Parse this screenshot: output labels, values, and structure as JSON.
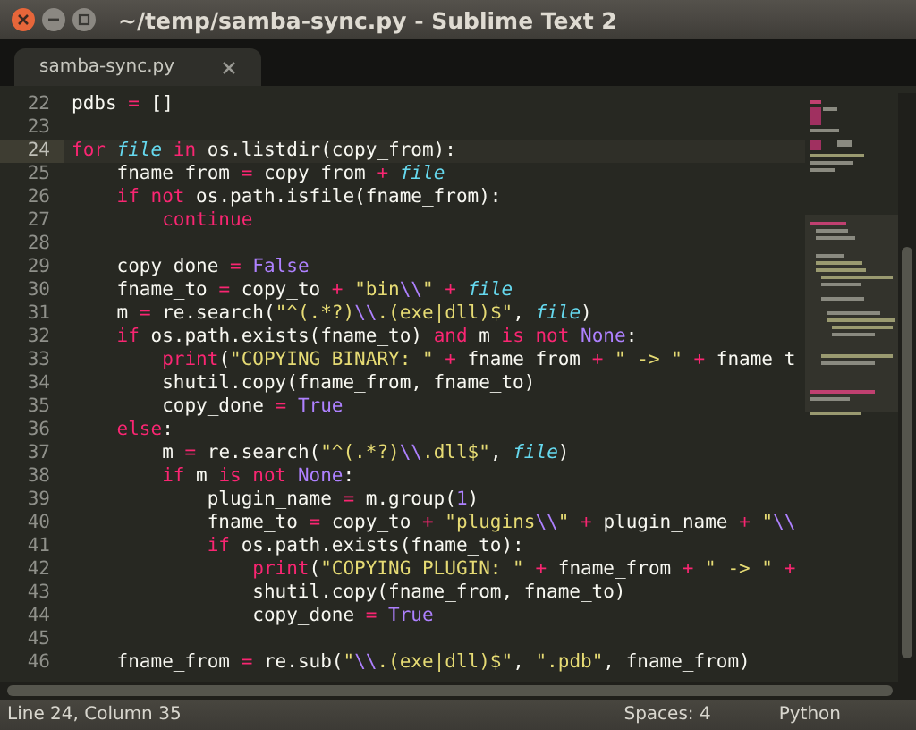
{
  "window": {
    "title": "~/temp/samba-sync.py - Sublime Text 2"
  },
  "tabs": [
    {
      "label": "samba-sync.py",
      "selected": true
    }
  ],
  "editor": {
    "lines": [
      {
        "number": "22",
        "current": false,
        "tokens": [
          {
            "kind": "plain",
            "text": "pdbs "
          },
          {
            "kind": "operator",
            "text": "="
          },
          {
            "kind": "plain",
            "text": " []"
          }
        ]
      },
      {
        "number": "23",
        "current": false
      },
      {
        "number": "24",
        "current": true,
        "tokens": [
          {
            "kind": "keyword",
            "text": "for"
          },
          {
            "kind": "name",
            "text": " file"
          },
          {
            "kind": "keyword",
            "text": " in"
          },
          {
            "kind": "plain",
            "text": " os.listdir(copy_from):"
          }
        ]
      },
      {
        "number": "25",
        "current": false,
        "tokens": [
          {
            "kind": "plain",
            "text": "    fname_from "
          },
          {
            "kind": "operator",
            "text": "="
          },
          {
            "kind": "plain",
            "text": " copy_from "
          },
          {
            "kind": "operator",
            "text": "+"
          },
          {
            "kind": "name",
            "text": " file"
          }
        ]
      },
      {
        "number": "26",
        "current": false,
        "tokens": [
          {
            "kind": "keyword",
            "text": "    if"
          },
          {
            "kind": "keyword",
            "text": " not"
          },
          {
            "kind": "plain",
            "text": " os.path.isfile(fname_from):"
          }
        ]
      },
      {
        "number": "27",
        "current": false,
        "tokens": [
          {
            "kind": "keyword",
            "text": "        continue"
          }
        ]
      },
      {
        "number": "28",
        "current": false
      },
      {
        "number": "29",
        "current": false,
        "tokens": [
          {
            "kind": "plain",
            "text": "    copy_done "
          },
          {
            "kind": "operator",
            "text": "="
          },
          {
            "kind": "constant",
            "text": " False"
          }
        ]
      },
      {
        "number": "30",
        "current": false,
        "tokens": [
          {
            "kind": "plain",
            "text": "    fname_to "
          },
          {
            "kind": "operator",
            "text": "="
          },
          {
            "kind": "plain",
            "text": " copy_to "
          },
          {
            "kind": "operator",
            "text": "+"
          },
          {
            "kind": "string",
            "text": " \"bin"
          },
          {
            "kind": "constant",
            "text": "\\\\"
          },
          {
            "kind": "string",
            "text": "\""
          },
          {
            "kind": "operator",
            "text": " +"
          },
          {
            "kind": "name",
            "text": " file"
          }
        ]
      },
      {
        "number": "31",
        "current": false,
        "tokens": [
          {
            "kind": "plain",
            "text": "    m "
          },
          {
            "kind": "operator",
            "text": "="
          },
          {
            "kind": "plain",
            "text": " re.search("
          },
          {
            "kind": "string",
            "text": "\"^(.*?)"
          },
          {
            "kind": "constant",
            "text": "\\\\"
          },
          {
            "kind": "string",
            "text": ".(exe|dll)$\""
          },
          {
            "kind": "plain",
            "text": ","
          },
          {
            "kind": "name",
            "text": " file"
          },
          {
            "kind": "plain",
            "text": ")"
          }
        ]
      },
      {
        "number": "32",
        "current": false,
        "tokens": [
          {
            "kind": "keyword",
            "text": "    if"
          },
          {
            "kind": "plain",
            "text": " os.path.exists(fname_to) "
          },
          {
            "kind": "keyword",
            "text": "and"
          },
          {
            "kind": "plain",
            "text": " m "
          },
          {
            "kind": "keyword",
            "text": "is"
          },
          {
            "kind": "keyword",
            "text": " not"
          },
          {
            "kind": "constant",
            "text": " None"
          },
          {
            "kind": "plain",
            "text": ":"
          }
        ]
      },
      {
        "number": "33",
        "current": false,
        "tokens": [
          {
            "kind": "keyword",
            "text": "        print"
          },
          {
            "kind": "plain",
            "text": "("
          },
          {
            "kind": "string",
            "text": "\"COPYING BINARY: \""
          },
          {
            "kind": "operator",
            "text": " +"
          },
          {
            "kind": "plain",
            "text": " fname_from "
          },
          {
            "kind": "operator",
            "text": "+"
          },
          {
            "kind": "string",
            "text": " \" -> \""
          },
          {
            "kind": "operator",
            "text": " +"
          },
          {
            "kind": "plain",
            "text": " fname_t"
          }
        ]
      },
      {
        "number": "34",
        "current": false,
        "tokens": [
          {
            "kind": "plain",
            "text": "        shutil.copy(fname_from, fname_to)"
          }
        ]
      },
      {
        "number": "35",
        "current": false,
        "tokens": [
          {
            "kind": "plain",
            "text": "        copy_done "
          },
          {
            "kind": "operator",
            "text": "="
          },
          {
            "kind": "constant",
            "text": " True"
          }
        ]
      },
      {
        "number": "36",
        "current": false,
        "tokens": [
          {
            "kind": "keyword",
            "text": "    else"
          },
          {
            "kind": "plain",
            "text": ":"
          }
        ]
      },
      {
        "number": "37",
        "current": false,
        "tokens": [
          {
            "kind": "plain",
            "text": "        m "
          },
          {
            "kind": "operator",
            "text": "="
          },
          {
            "kind": "plain",
            "text": " re.search("
          },
          {
            "kind": "string",
            "text": "\"^(.*?)"
          },
          {
            "kind": "constant",
            "text": "\\\\"
          },
          {
            "kind": "string",
            "text": ".dll$\""
          },
          {
            "kind": "plain",
            "text": ","
          },
          {
            "kind": "name",
            "text": " file"
          },
          {
            "kind": "plain",
            "text": ")"
          }
        ]
      },
      {
        "number": "38",
        "current": false,
        "tokens": [
          {
            "kind": "keyword",
            "text": "        if"
          },
          {
            "kind": "plain",
            "text": " m "
          },
          {
            "kind": "keyword",
            "text": "is"
          },
          {
            "kind": "keyword",
            "text": " not"
          },
          {
            "kind": "constant",
            "text": " None"
          },
          {
            "kind": "plain",
            "text": ":"
          }
        ]
      },
      {
        "number": "39",
        "current": false,
        "tokens": [
          {
            "kind": "plain",
            "text": "            plugin_name "
          },
          {
            "kind": "operator",
            "text": "="
          },
          {
            "kind": "plain",
            "text": " m.group("
          },
          {
            "kind": "constant",
            "text": "1"
          },
          {
            "kind": "plain",
            "text": ")"
          }
        ]
      },
      {
        "number": "40",
        "current": false,
        "tokens": [
          {
            "kind": "plain",
            "text": "            fname_to "
          },
          {
            "kind": "operator",
            "text": "="
          },
          {
            "kind": "plain",
            "text": " copy_to "
          },
          {
            "kind": "operator",
            "text": "+"
          },
          {
            "kind": "string",
            "text": " \"plugins"
          },
          {
            "kind": "constant",
            "text": "\\\\"
          },
          {
            "kind": "string",
            "text": "\""
          },
          {
            "kind": "operator",
            "text": " +"
          },
          {
            "kind": "plain",
            "text": " plugin_name "
          },
          {
            "kind": "operator",
            "text": "+"
          },
          {
            "kind": "string",
            "text": " \""
          },
          {
            "kind": "constant",
            "text": "\\\\"
          }
        ]
      },
      {
        "number": "41",
        "current": false,
        "tokens": [
          {
            "kind": "keyword",
            "text": "            if"
          },
          {
            "kind": "plain",
            "text": " os.path.exists(fname_to):"
          }
        ]
      },
      {
        "number": "42",
        "current": false,
        "tokens": [
          {
            "kind": "keyword",
            "text": "                print"
          },
          {
            "kind": "plain",
            "text": "("
          },
          {
            "kind": "string",
            "text": "\"COPYING PLUGIN: \""
          },
          {
            "kind": "operator",
            "text": " +"
          },
          {
            "kind": "plain",
            "text": " fname_from "
          },
          {
            "kind": "operator",
            "text": "+"
          },
          {
            "kind": "string",
            "text": " \" -> \""
          },
          {
            "kind": "operator",
            "text": " +"
          }
        ]
      },
      {
        "number": "43",
        "current": false,
        "tokens": [
          {
            "kind": "plain",
            "text": "                shutil.copy(fname_from, fname_to)"
          }
        ]
      },
      {
        "number": "44",
        "current": false,
        "tokens": [
          {
            "kind": "plain",
            "text": "                copy_done "
          },
          {
            "kind": "operator",
            "text": "="
          },
          {
            "kind": "constant",
            "text": " True"
          }
        ]
      },
      {
        "number": "45",
        "current": false
      },
      {
        "number": "46",
        "current": false,
        "tokens": [
          {
            "kind": "plain",
            "text": "    fname_from "
          },
          {
            "kind": "operator",
            "text": "="
          },
          {
            "kind": "plain",
            "text": " re.sub("
          },
          {
            "kind": "string",
            "text": "\""
          },
          {
            "kind": "constant",
            "text": "\\\\"
          },
          {
            "kind": "string",
            "text": ".(exe|dll)$\""
          },
          {
            "kind": "plain",
            "text": ","
          },
          {
            "kind": "string",
            "text": " \".pdb\""
          },
          {
            "kind": "plain",
            "text": ", fname_from)"
          }
        ]
      }
    ]
  },
  "status_bar": {
    "position": "Line 24, Column 35",
    "indentation": "Spaces: 4",
    "syntax": "Python"
  }
}
